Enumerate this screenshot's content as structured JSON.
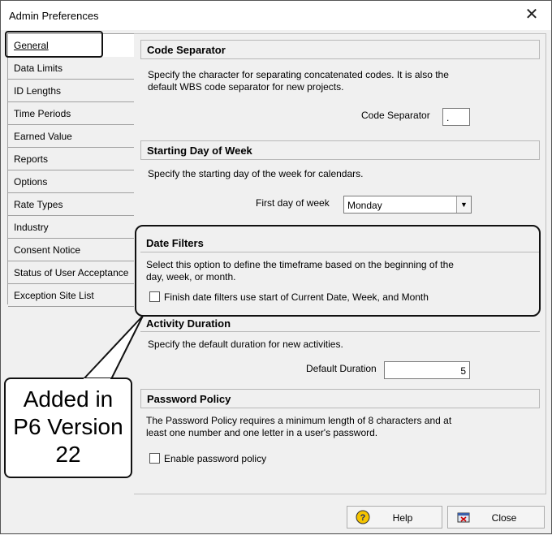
{
  "window": {
    "title": "Admin Preferences"
  },
  "sidebar": {
    "items": [
      {
        "label": "General"
      },
      {
        "label": "Data Limits"
      },
      {
        "label": "ID Lengths"
      },
      {
        "label": "Time Periods"
      },
      {
        "label": "Earned Value"
      },
      {
        "label": "Reports"
      },
      {
        "label": "Options"
      },
      {
        "label": "Rate Types"
      },
      {
        "label": "Industry"
      },
      {
        "label": "Consent Notice"
      },
      {
        "label": "Status of User Acceptance"
      },
      {
        "label": "Exception Site List"
      }
    ]
  },
  "code_separator": {
    "header": "Code Separator",
    "desc1": "Specify the character for separating concatenated codes.  It is also the",
    "desc2": "default WBS code separator for new projects.",
    "label": "Code Separator",
    "value": "."
  },
  "starting_day": {
    "header": "Starting Day of Week",
    "desc": "Specify the starting day of the week for calendars.",
    "label": "First day of week",
    "value": "Monday"
  },
  "date_filters": {
    "header": "Date Filters",
    "desc1": "Select this option to define the timeframe based on the beginning of the",
    "desc2": "day, week, or month.",
    "checkbox_label": "Finish date filters use start of Current Date, Week, and Month"
  },
  "activity_duration": {
    "header": "Activity Duration",
    "desc": "Specify the default duration for new activities.",
    "label": "Default Duration",
    "value": "5"
  },
  "password_policy": {
    "header": "Password Policy",
    "desc1": "The Password Policy requires a minimum length of 8 characters and at",
    "desc2": "least one number and one letter in a user's password.",
    "checkbox_label": "Enable password policy"
  },
  "callout": {
    "line1": "Added in",
    "line2": "P6 Version",
    "line3": "22"
  },
  "buttons": {
    "help": "Help",
    "close": "Close"
  },
  "colors": {
    "accent": "#000000",
    "help_icon": "#f5c400"
  }
}
